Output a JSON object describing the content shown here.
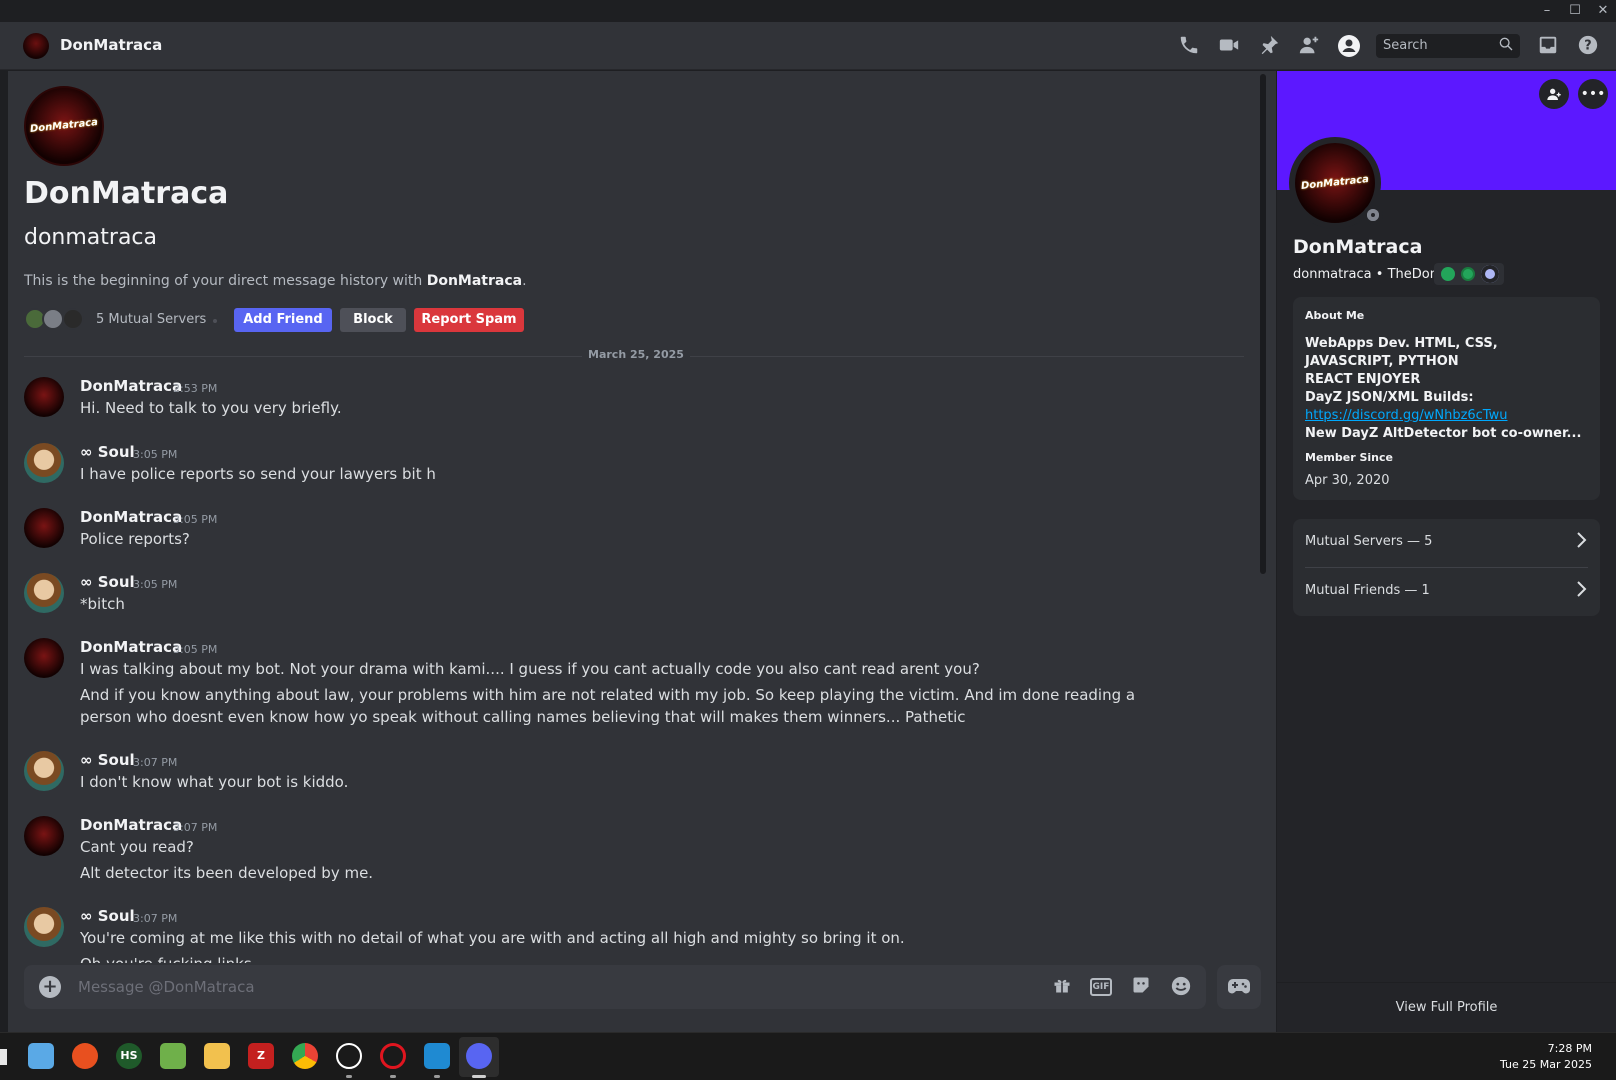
{
  "window": {
    "minimize_glyph": "–",
    "maximize_glyph": "☐",
    "close_glyph": "✕"
  },
  "topbar": {
    "title": "DonMatraca",
    "search_placeholder": "Search",
    "icons": [
      "phone-icon",
      "video-icon",
      "pin-icon",
      "add-member-icon",
      "profile-toggle-icon",
      "inbox-icon",
      "help-icon"
    ]
  },
  "hero": {
    "display_name": "DonMatraca",
    "username": "donmatraca",
    "intro_prefix": "This is the beginning of your direct message history with ",
    "intro_name": "DonMatraca",
    "intro_suffix": ".",
    "mutual_servers": "5 Mutual Servers",
    "add_friend": "Add Friend",
    "block": "Block",
    "report_spam": "Report Spam",
    "logo_text": "DonMatraca"
  },
  "date_divider": "March 25, 2025",
  "messages": [
    {
      "author": "DonMatraca",
      "time": "2:53 PM",
      "lines": [
        "Hi. Need to talk to you very briefly."
      ]
    },
    {
      "author": "∞ Soul",
      "time": "3:05 PM",
      "lines": [
        "I have police reports so send your lawyers bit h"
      ]
    },
    {
      "author": "DonMatraca",
      "time": "3:05 PM",
      "lines": [
        "Police reports?"
      ]
    },
    {
      "author": "∞ Soul",
      "time": "3:05 PM",
      "lines": [
        "*bitch"
      ]
    },
    {
      "author": "DonMatraca",
      "time": "3:05 PM",
      "lines": [
        "I was talking about my bot. Not your drama with kami.... I guess if you cant actually code you also cant read arent you?",
        "And if you know anything about law, your problems with him are not related with my job. So keep playing the victim. And im done reading a person who doesnt even know how yo speak without calling names believing that will makes them winners... Pathetic"
      ]
    },
    {
      "author": "∞ Soul",
      "time": "3:07 PM",
      "lines": [
        "I don't know what your bot is kiddo."
      ]
    },
    {
      "author": "DonMatraca",
      "time": "3:07 PM",
      "lines": [
        "Cant you read?",
        "Alt detector its been developed by me."
      ]
    },
    {
      "author": "∞ Soul",
      "time": "3:07 PM",
      "lines": [
        "You're coming at me like this with no detail of what you are with and acting all high and mighty so bring it on.",
        "Oh you're fucking links"
      ]
    }
  ],
  "composer": {
    "placeholder": "Message @DonMatraca",
    "gif_label": "GIF"
  },
  "profile": {
    "display_name": "DonMatraca",
    "username": "donmatraca",
    "separator": "•",
    "pronoun_tag": "TheDon",
    "about_label": "About Me",
    "about_lines": [
      "WebApps Dev. HTML, CSS, JAVASCRIPT, PYTHON",
      "REACT ENJOYER",
      "DayZ JSON/XML Builds:"
    ],
    "about_link": "https://discord.gg/wNhbz6cTwu",
    "about_last": "New DayZ AltDetector bot co-owner...",
    "member_since_label": "Member Since",
    "member_since": "Apr 30, 2020",
    "mutual_servers": "Mutual Servers — 5",
    "mutual_friends": "Mutual Friends — 1",
    "view_full": "View Full Profile",
    "banner_color": "#5c18ff"
  },
  "taskbar": {
    "time": "7:28 PM",
    "date": "Tue 25 Mar 2025",
    "apps": [
      "notepad-icon",
      "git-icon",
      "hs-icon",
      "sheet-icon",
      "folder-icon",
      "filezilla-icon",
      "chrome-icon",
      "chatgpt-icon",
      "opera-icon",
      "vscode-icon",
      "discord-icon"
    ],
    "hs_label": "HS",
    "fz_label": "Z"
  }
}
